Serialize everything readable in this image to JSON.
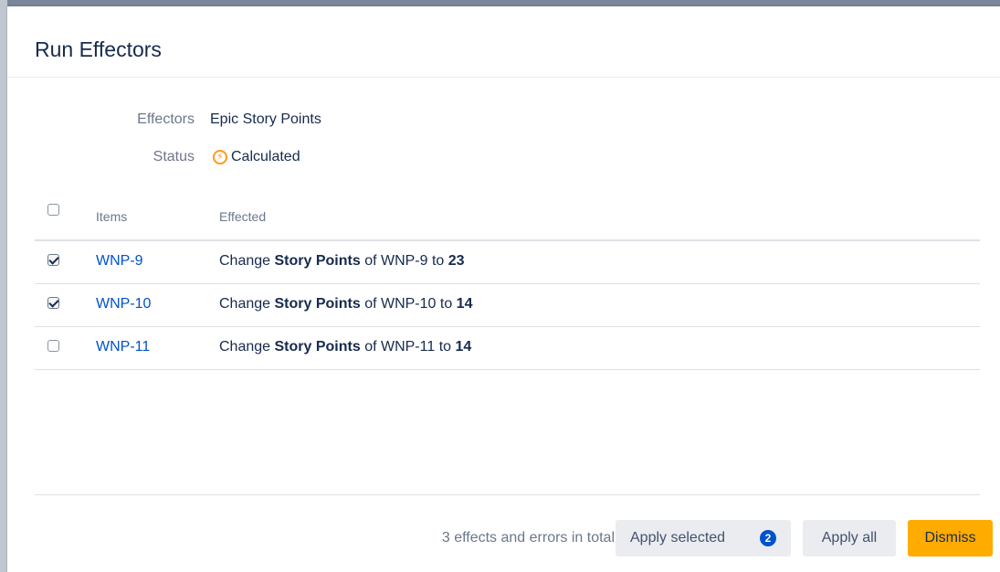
{
  "dialog": {
    "title": "Run Effectors"
  },
  "meta": {
    "effectors_label": "Effectors",
    "effectors_value": "Epic Story Points",
    "status_label": "Status",
    "status_value": "Calculated",
    "status_icon": "lightning-icon"
  },
  "table": {
    "headers": {
      "items": "Items",
      "effected": "Effected"
    },
    "rows": [
      {
        "checked": true,
        "item": "WNP-9",
        "prefix": "Change",
        "field": "Story Points",
        "middle": "of WNP-9 to",
        "value": "23"
      },
      {
        "checked": true,
        "item": "WNP-10",
        "prefix": "Change",
        "field": "Story Points",
        "middle": "of WNP-10 to",
        "value": "14"
      },
      {
        "checked": false,
        "item": "WNP-11",
        "prefix": "Change",
        "field": "Story Points",
        "middle": "of WNP-11 to",
        "value": "14"
      }
    ]
  },
  "footer": {
    "total_text": "3 effects and errors in total",
    "apply_selected_label": "Apply selected",
    "apply_selected_count": "2",
    "apply_all_label": "Apply all",
    "dismiss_label": "Dismiss"
  },
  "colors": {
    "accent": "#0052cc",
    "warning": "#ffab00",
    "status_icon": "#ff991f"
  }
}
